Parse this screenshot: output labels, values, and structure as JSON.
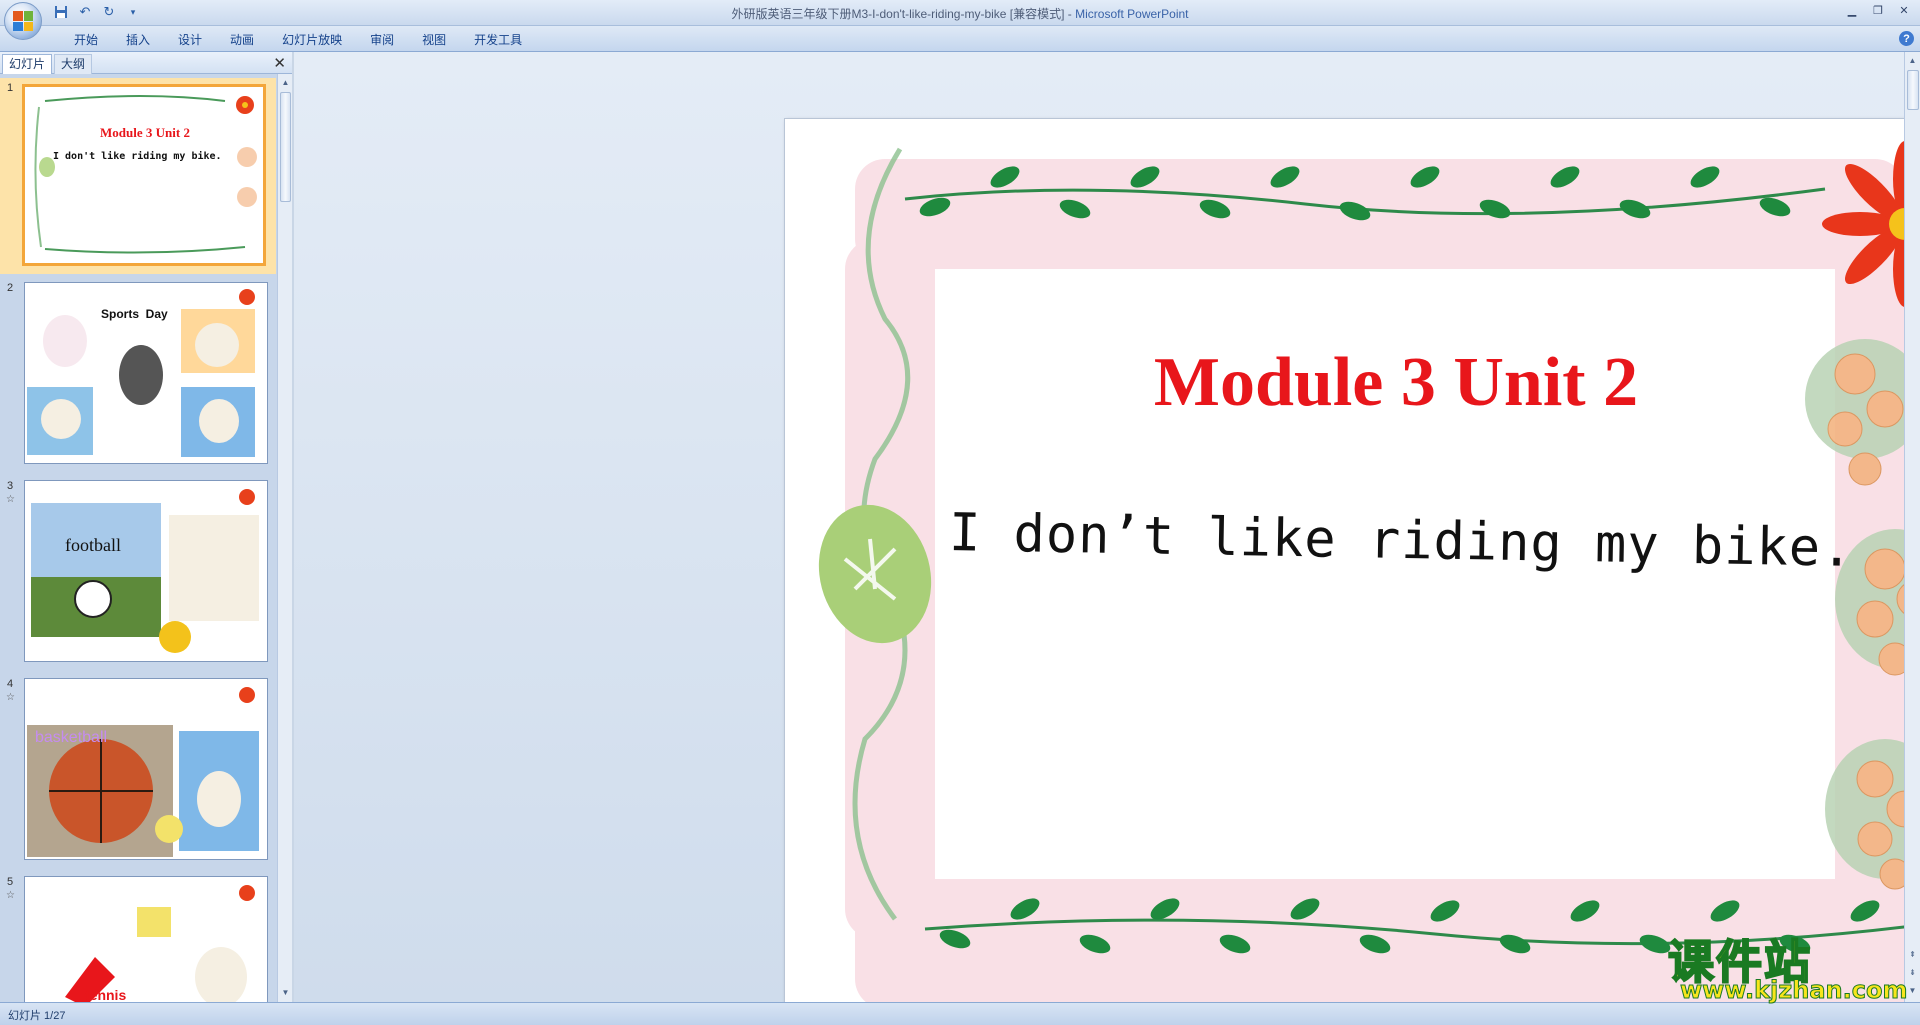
{
  "window": {
    "title_doc": "外研版英语三年级下册M3-I-don't-like-riding-my-bike [兼容模式] - ",
    "title_app": "Microsoft PowerPoint"
  },
  "ribbon": {
    "tabs": [
      "开始",
      "插入",
      "设计",
      "动画",
      "幻灯片放映",
      "审阅",
      "视图",
      "开发工具"
    ]
  },
  "left_panel": {
    "tabs": [
      "幻灯片",
      "大纲"
    ],
    "thumbnails": [
      {
        "number": "1",
        "title": "Module 3 Unit 2",
        "subtitle": "I don't like riding my bike."
      },
      {
        "number": "2",
        "label": "Sports  Day"
      },
      {
        "number": "3",
        "label": "football"
      },
      {
        "number": "4",
        "label": "basketball"
      },
      {
        "number": "5",
        "label": "tennis"
      }
    ]
  },
  "slide": {
    "title": "Module 3 Unit 2",
    "subtitle": "I don’t like riding my bike."
  },
  "status": {
    "slide_counter": "幻灯片 1/27"
  },
  "watermark": {
    "main": "课件站",
    "url": "www.kjzhan.com"
  },
  "colors": {
    "title_red": "#e8161b",
    "selected_thumb": "#f3a63a"
  }
}
